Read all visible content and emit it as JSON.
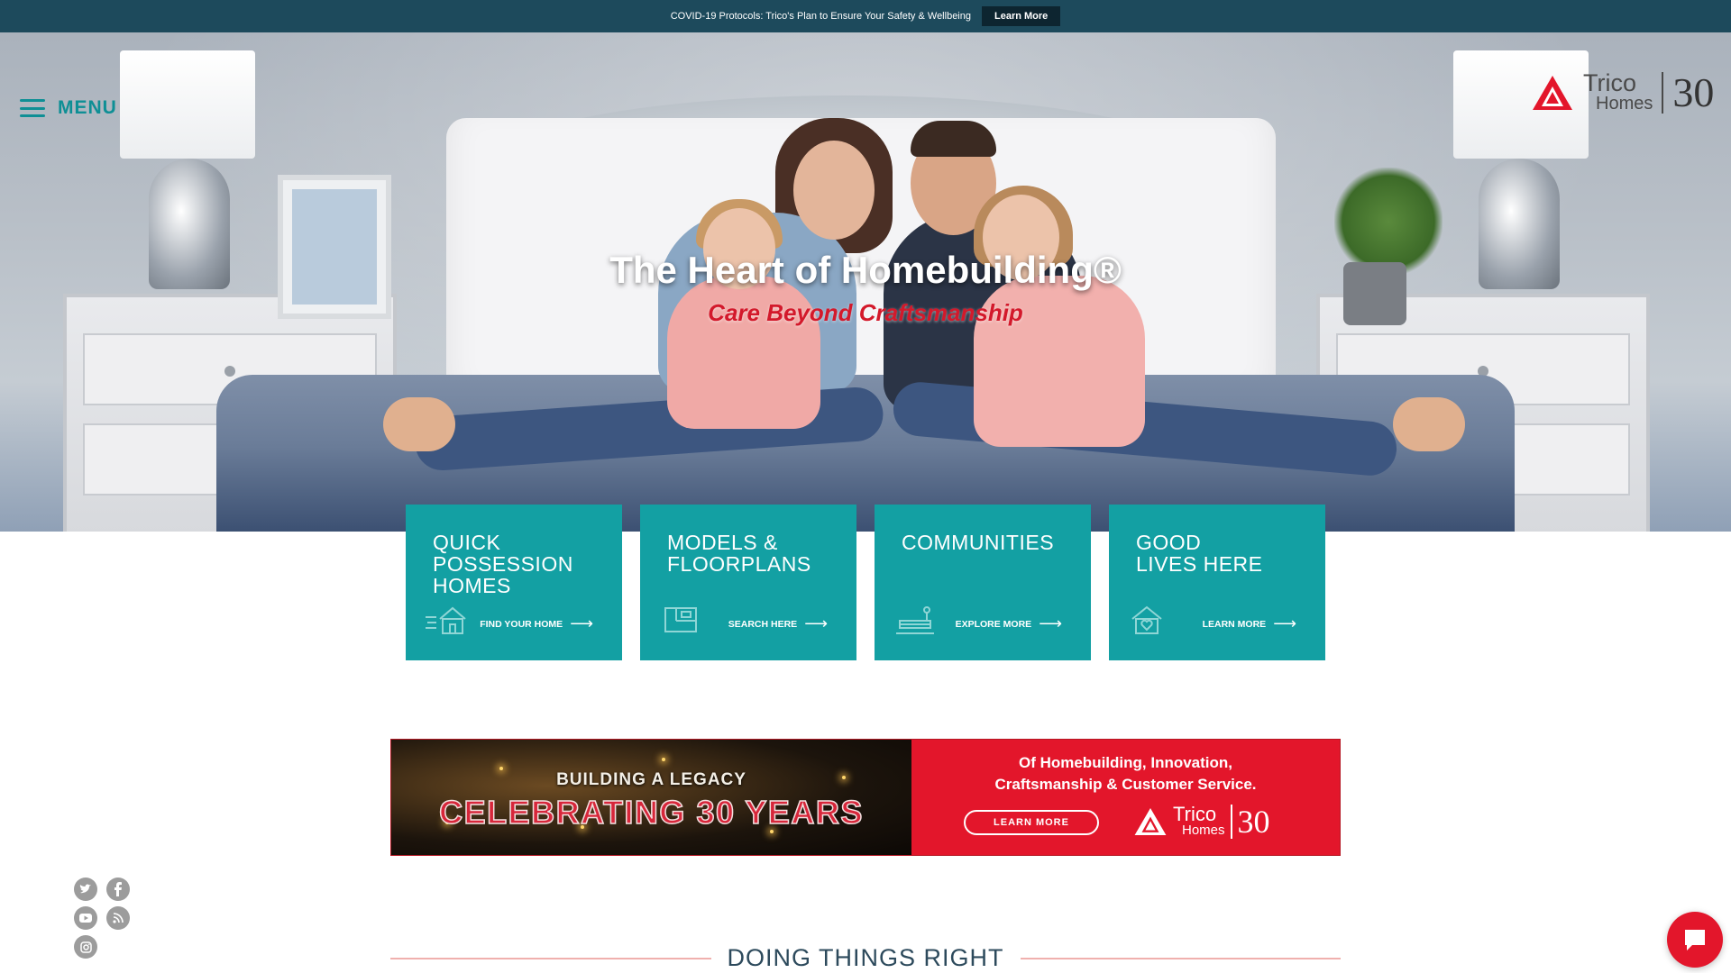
{
  "notice": {
    "text": "COVID-19 Protocols: Trico's Plan to Ensure Your Safety & Wellbeing",
    "button": "Learn More"
  },
  "header": {
    "menu_label": "MENU",
    "logo_name_top": "Trico",
    "logo_name_bottom": "Homes",
    "logo_anniversary": "30"
  },
  "hero": {
    "title": "The Heart of Homebuilding®",
    "subtitle": "Care Beyond Craftsmanship"
  },
  "tiles": [
    {
      "title": "QUICK\nPOSSESSION\nHOMES",
      "link": "FIND YOUR HOME",
      "icon": "moving-house-icon"
    },
    {
      "title": "MODELS &\nFLOORPLANS",
      "link": "SEARCH HERE",
      "icon": "floorplan-icon"
    },
    {
      "title": "COMMUNITIES",
      "link": "EXPLORE MORE",
      "icon": "community-icon"
    },
    {
      "title": "GOOD\nLIVES HERE",
      "link": "LEARN MORE",
      "icon": "home-heart-icon"
    }
  ],
  "banner": {
    "pre_title": "BUILDING A LEGACY",
    "headline": "CELEBRATING 30 YEARS",
    "text": "Of Homebuilding, Innovation,\nCraftsmanship & Customer Service.",
    "button": "LEARN MORE",
    "logo_name_top": "Trico",
    "logo_name_bottom": "Homes",
    "logo_anniversary": "30"
  },
  "social": {
    "icons": [
      "twitter-icon",
      "facebook-icon",
      "youtube-icon",
      "rss-icon",
      "instagram-icon"
    ]
  },
  "section": {
    "title": "DOING THINGS RIGHT"
  },
  "colors": {
    "teal": "#13a0a3",
    "notice_bg": "#1d4a5c",
    "brand_red": "#e3162b"
  }
}
